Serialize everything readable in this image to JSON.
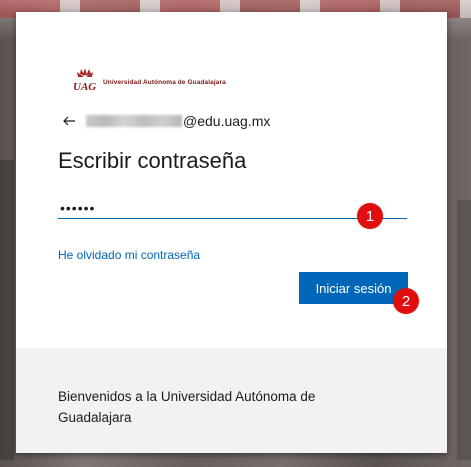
{
  "brand": {
    "logo_text": "UAG",
    "university_name": "Universidad Autónoma de Guadalajara",
    "brand_color": "#7a1a1a"
  },
  "account": {
    "email_suffix": "@edu.uag.mx"
  },
  "form": {
    "title": "Escribir contraseña",
    "password_masked": "••••••",
    "forgot_link": "He olvidado mi contraseña",
    "submit_label": "Iniciar sesión"
  },
  "footer": {
    "message": "Bienvenidos a la Universidad Autónoma de Guadalajara"
  },
  "annotations": {
    "step1": "1",
    "step2": "2"
  },
  "icons": {
    "back": "back-arrow-icon"
  },
  "colors": {
    "accent": "#0067b8",
    "badge": "#e00e0e"
  }
}
